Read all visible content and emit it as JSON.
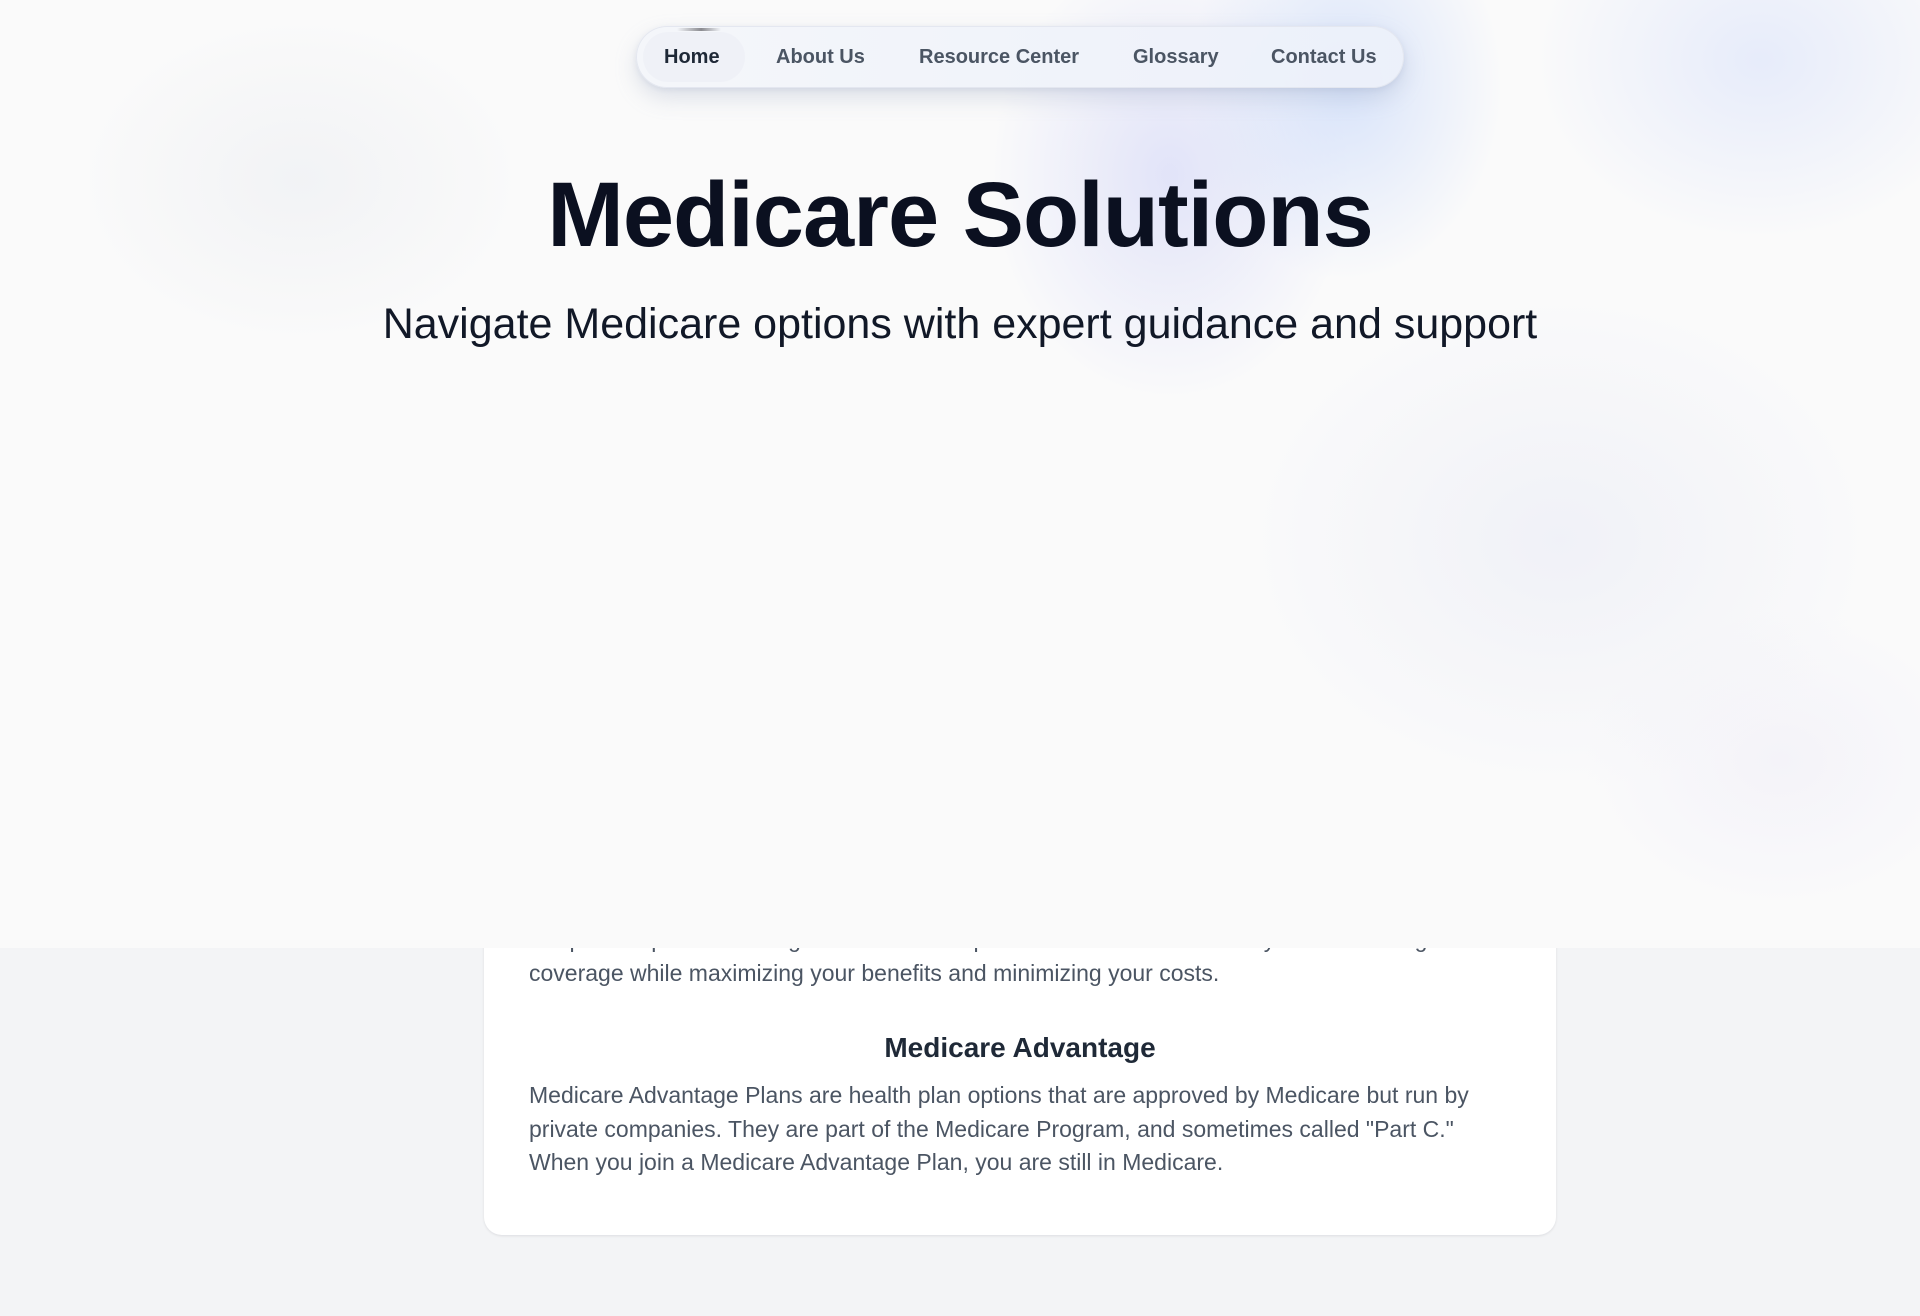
{
  "nav": {
    "items": [
      {
        "label": "Home",
        "active": true
      },
      {
        "label": "About Us",
        "active": false
      },
      {
        "label": "Resource Center",
        "active": false
      },
      {
        "label": "Glossary",
        "active": false
      },
      {
        "label": "Contact Us",
        "active": false
      }
    ]
  },
  "hero": {
    "title": "Medicare Solutions",
    "subtitle": "Navigate Medicare options with expert guidance and support"
  },
  "content": {
    "intro": "We provide personalized guidance on all aspects of Medicare to ensure you have the right coverage while maximizing your benefits and minimizing your costs.",
    "section_heading": "Medicare Advantage",
    "section_body": "Medicare Advantage Plans are health plan options that are approved by Medicare but run by private companies. They are part of the Medicare Program, and sometimes called \"Part C.\" When you join a Medicare Advantage Plan, you are still in Medicare."
  },
  "colors": {
    "page_background": "#f3f4f6",
    "hero_background": "#fafafa",
    "title_text": "#0b1020",
    "body_text": "#4b5563",
    "nav_text": "#4b5563",
    "nav_active_text": "#1f2937"
  }
}
